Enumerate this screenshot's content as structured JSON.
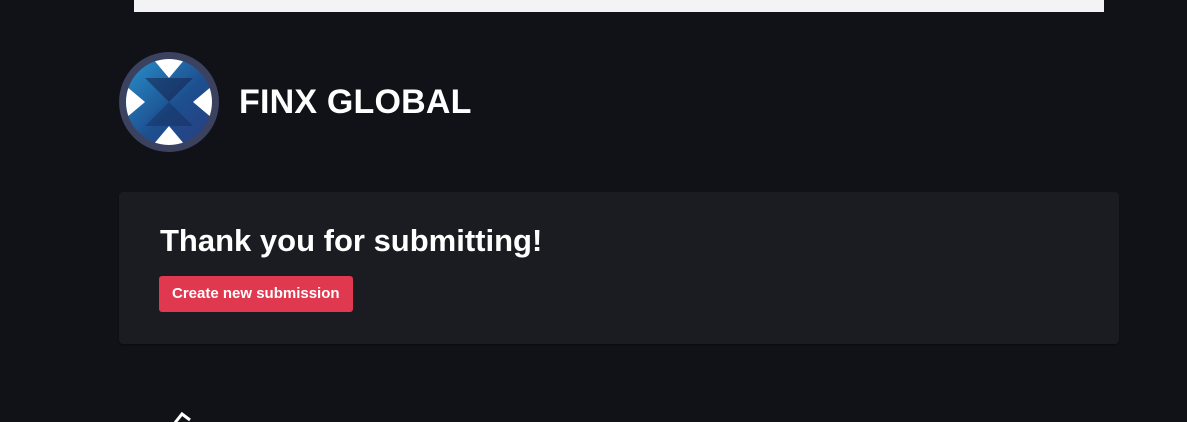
{
  "brand": {
    "name": "FINX GLOBAL",
    "logo_icon": "finx-logo-icon"
  },
  "card": {
    "title": "Thank you for submitting!",
    "button_label": "Create new submission"
  },
  "colors": {
    "page_background": "#111217",
    "card_background": "#1b1c21",
    "button_accent": "#e0384f",
    "banner": "#f3f3f6"
  }
}
